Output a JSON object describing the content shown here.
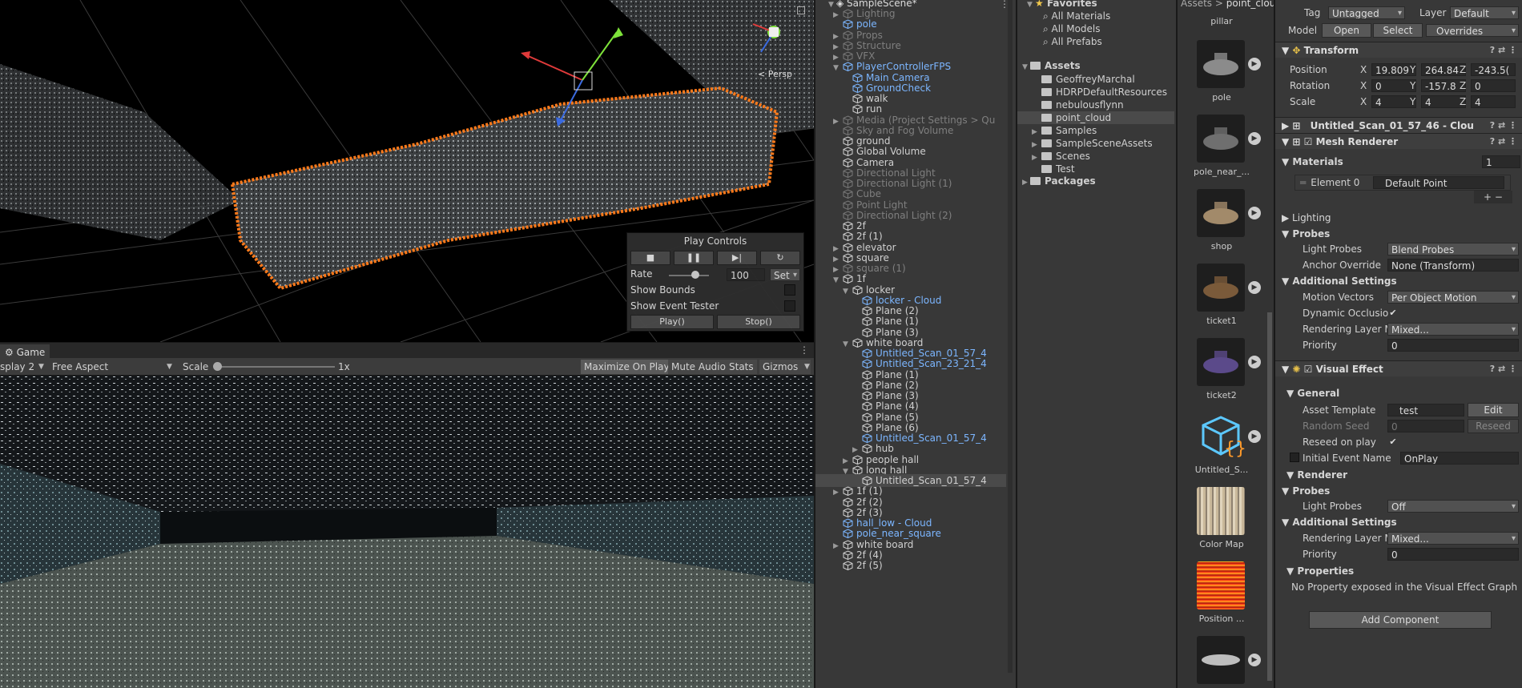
{
  "scene": {
    "persp_label": "< Persp"
  },
  "play_controls": {
    "title": "Play Controls",
    "rate_label": "Rate",
    "rate_value": "100",
    "set_label": "Set",
    "show_bounds": "Show Bounds",
    "show_event_tester": "Show Event Tester",
    "play_btn": "Play()",
    "stop_btn": "Stop()"
  },
  "game": {
    "tab": "Game",
    "display": "splay 2",
    "aspect": "Free Aspect",
    "scale_label": "Scale",
    "scale_value": "1x",
    "maximize": "Maximize On Play",
    "mute": "Mute Audio",
    "stats": "Stats",
    "gizmos": "Gizmos"
  },
  "hierarchy": {
    "scene_name": "SampleScene*",
    "items": [
      {
        "label": "Lighting",
        "style": "dim"
      },
      {
        "label": "pole",
        "style": "pre"
      },
      {
        "label": "Props",
        "style": "dim"
      },
      {
        "label": "Structure",
        "style": "dim"
      },
      {
        "label": "VFX",
        "style": "dim"
      },
      {
        "label": "PlayerControllerFPS",
        "style": "pre"
      },
      {
        "label": "Main Camera",
        "style": "pre"
      },
      {
        "label": "GroundCheck",
        "style": "pre"
      },
      {
        "label": "walk",
        "style": ""
      },
      {
        "label": "run",
        "style": ""
      },
      {
        "label": "Media (Project Settings > Qu",
        "style": "dim"
      },
      {
        "label": "Sky and Fog Volume",
        "style": "dim"
      },
      {
        "label": "ground",
        "style": ""
      },
      {
        "label": "Global Volume",
        "style": ""
      },
      {
        "label": "Camera",
        "style": ""
      },
      {
        "label": "Directional Light",
        "style": "dim"
      },
      {
        "label": "Directional Light (1)",
        "style": "dim"
      },
      {
        "label": "Cube",
        "style": "dim"
      },
      {
        "label": "Point Light",
        "style": "dim"
      },
      {
        "label": "Directional Light (2)",
        "style": "dim"
      },
      {
        "label": "2f",
        "style": ""
      },
      {
        "label": "2f (1)",
        "style": ""
      },
      {
        "label": "elevator",
        "style": ""
      },
      {
        "label": "square",
        "style": ""
      },
      {
        "label": "square (1)",
        "style": "dim"
      },
      {
        "label": "1f",
        "style": ""
      },
      {
        "label": "locker",
        "style": ""
      },
      {
        "label": "locker - Cloud",
        "style": "pre"
      },
      {
        "label": "Plane (2)",
        "style": ""
      },
      {
        "label": "Plane (1)",
        "style": ""
      },
      {
        "label": "Plane (3)",
        "style": ""
      },
      {
        "label": "white board",
        "style": ""
      },
      {
        "label": "Untitled_Scan_01_57_4",
        "style": "pre"
      },
      {
        "label": "Untitled_Scan_23_21_4",
        "style": "pre"
      },
      {
        "label": "Plane (1)",
        "style": ""
      },
      {
        "label": "Plane (2)",
        "style": ""
      },
      {
        "label": "Plane (3)",
        "style": ""
      },
      {
        "label": "Plane (4)",
        "style": ""
      },
      {
        "label": "Plane (5)",
        "style": ""
      },
      {
        "label": "Plane (6)",
        "style": ""
      },
      {
        "label": "Untitled_Scan_01_57_4",
        "style": "pre"
      },
      {
        "label": "hub",
        "style": ""
      },
      {
        "label": "people hall",
        "style": ""
      },
      {
        "label": "long hall",
        "style": ""
      },
      {
        "label": "Untitled_Scan_01_57_4",
        "style": "sel"
      },
      {
        "label": "1f (1)",
        "style": ""
      },
      {
        "label": "2f (2)",
        "style": ""
      },
      {
        "label": "2f (3)",
        "style": ""
      },
      {
        "label": "hall_low - Cloud",
        "style": "pre"
      },
      {
        "label": "pole_near_square",
        "style": "pre"
      },
      {
        "label": "white board",
        "style": ""
      },
      {
        "label": "2f (4)",
        "style": ""
      },
      {
        "label": "2f (5)",
        "style": ""
      }
    ]
  },
  "project": {
    "favorites": "Favorites",
    "fav_items": [
      "All Materials",
      "All Models",
      "All Prefabs"
    ],
    "assets": "Assets",
    "folders": [
      "GeoffreyMarchal",
      "HDRPDefaultResources",
      "nebulousflynn",
      "point_cloud",
      "Samples",
      "SampleSceneAssets",
      "Scenes",
      "Test"
    ],
    "packages": "Packages"
  },
  "asset_browser": {
    "breadcrumb_root": "Assets",
    "breadcrumb_sep": ">",
    "breadcrumb_current": "point_clou",
    "top_label": "pillar",
    "items": [
      "pole",
      "pole_near_...",
      "shop",
      "ticket1",
      "ticket2",
      "Untitled_S...",
      "Color Map",
      "Position ..."
    ]
  },
  "inspector": {
    "tag_label": "Tag",
    "tag_value": "Untagged",
    "layer_label": "Layer",
    "layer_value": "Default",
    "model_label": "Model",
    "open_btn": "Open",
    "select_btn": "Select",
    "overrides_btn": "Overrides",
    "transform": {
      "title": "Transform",
      "position_label": "Position",
      "rotation_label": "Rotation",
      "scale_label": "Scale",
      "x": "X",
      "y": "Y",
      "z": "Z",
      "position": [
        "19.809",
        "264.84",
        "-243.5("
      ],
      "rotation": [
        "0",
        "-157.8",
        "0"
      ],
      "scale": [
        "4",
        "4",
        "4"
      ]
    },
    "mesh_filter_title": "Untitled_Scan_01_57_46 - Clou",
    "mesh_renderer": {
      "title": "Mesh Renderer",
      "materials_label": "Materials",
      "materials_count": "1",
      "element_label": "Element 0",
      "element_value": "Default Point",
      "lighting": "Lighting",
      "probes": "Probes",
      "light_probes_label": "Light Probes",
      "light_probes_value": "Blend Probes",
      "anchor_label": "Anchor Override",
      "anchor_value": "None (Transform)",
      "additional": "Additional Settings",
      "motion_label": "Motion Vectors",
      "motion_value": "Per Object Motion",
      "dyn_occ_label": "Dynamic Occlusio",
      "render_layer_label": "Rendering Layer M",
      "render_layer_value": "Mixed...",
      "priority_label": "Priority",
      "priority_value": "0"
    },
    "visual_effect": {
      "title": "Visual Effect",
      "general": "General",
      "asset_template_label": "Asset Template",
      "asset_template_value": "test",
      "edit_btn": "Edit",
      "random_seed_label": "Random Seed",
      "random_seed_value": "0",
      "reseed_btn": "Reseed",
      "reseed_on_play_label": "Reseed on play",
      "initial_event_label": "Initial Event Name",
      "initial_event_value": "OnPlay",
      "renderer": "Renderer",
      "probes": "Probes",
      "light_probes_label": "Light Probes",
      "light_probes_value": "Off",
      "additional": "Additional Settings",
      "render_layer_label": "Rendering Layer M",
      "render_layer_value": "Mixed...",
      "priority_label": "Priority",
      "priority_value": "0",
      "properties": "Properties",
      "no_props": "No Property exposed in the Visual Effect Graph"
    },
    "add_component": "Add Component"
  },
  "colors": {
    "accent": "#ff7a1a",
    "prefab": "#7cb6ff",
    "panel": "#383838"
  }
}
